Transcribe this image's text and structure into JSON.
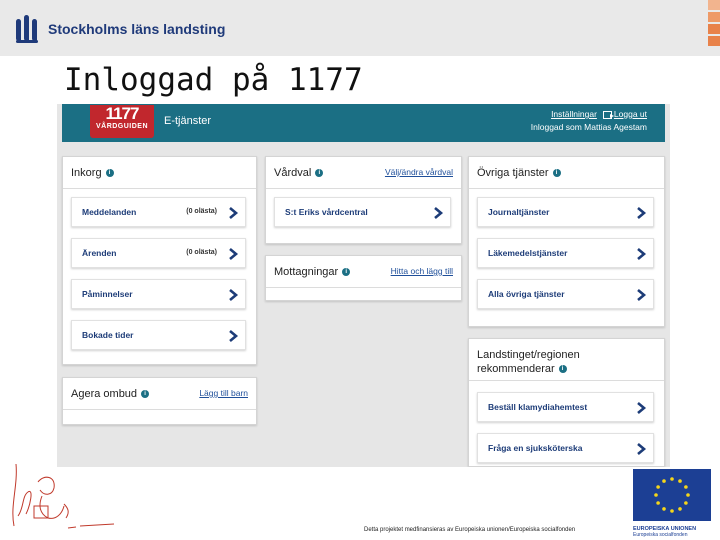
{
  "slide": {
    "org_name": "Stockholms läns landsting",
    "title": "Inloggad på 1177",
    "footer": "Detta projektet medfinansieras av Europeiska unionen/Europeiska socialfonden"
  },
  "eu": {
    "line1": "EUROPEISKA UNIONEN",
    "line2": "Europeiska socialfonden"
  },
  "app": {
    "brand_number": "1177",
    "brand_sub": "VÅRDGUIDEN",
    "section": "E-tjänster",
    "settings_link": "Inställningar",
    "logout_link": "Logga ut",
    "logged_in_as": "Inloggad som Mattias Agestam",
    "inkorg": {
      "title": "Inkorg",
      "rows": [
        {
          "label": "Meddelanden",
          "count": "(0 olästa)"
        },
        {
          "label": "Ärenden",
          "count": "(0 olästa)"
        },
        {
          "label": "Påminnelser"
        },
        {
          "label": "Bokade tider"
        }
      ]
    },
    "agera": {
      "title": "Agera ombud",
      "link": "Lägg till barn"
    },
    "vardval": {
      "title": "Vårdval",
      "link": "Välj/ändra vårdval",
      "rows": [
        {
          "label": "S:t Eriks vårdcentral"
        }
      ]
    },
    "mottagningar": {
      "title": "Mottagningar",
      "link": "Hitta och lägg till"
    },
    "ovriga": {
      "title": "Övriga tjänster",
      "rows": [
        {
          "label": "Journaltjänster"
        },
        {
          "label": "Läkemedelstjänster"
        },
        {
          "label": "Alla övriga tjänster"
        }
      ]
    },
    "rekommenderar": {
      "title_line1": "Landstinget/regionen",
      "title_line2": "rekommenderar",
      "rows": [
        {
          "label": "Beställ klamydiahemtest"
        },
        {
          "label": "Fråga en sjuksköterska"
        }
      ]
    }
  },
  "colors": {
    "header_teal": "#1b6f84",
    "brand_red": "#c1272d",
    "link_blue": "#1d3c78",
    "eu_blue": "#1c3f94"
  }
}
